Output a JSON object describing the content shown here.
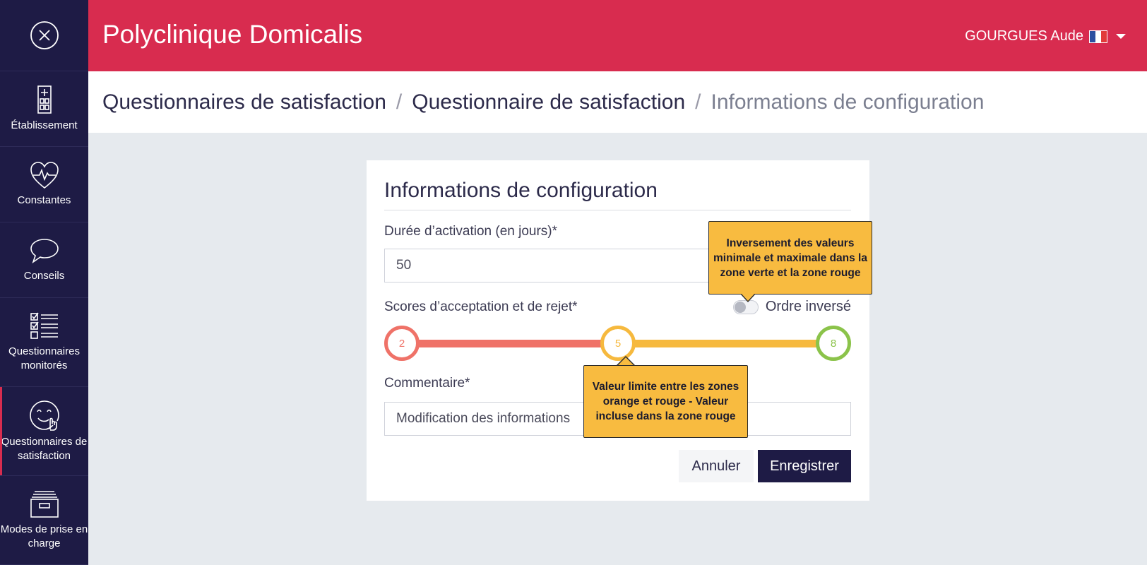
{
  "app": {
    "title": "Polyclinique Domicalis"
  },
  "user": {
    "name": "GOURGUES Aude",
    "flag_icon": "france-flag-icon"
  },
  "sidebar": {
    "items": [
      {
        "label": "Établissement",
        "icon": "hospital-icon"
      },
      {
        "label": "Constantes",
        "icon": "heart-pulse-icon"
      },
      {
        "label": "Conseils",
        "icon": "speech-bubble-icon"
      },
      {
        "label": "Questionnaires monitorés",
        "icon": "checklist-icon"
      },
      {
        "label": "Questionnaires de satisfaction",
        "icon": "smiley-icon",
        "active": true
      },
      {
        "label": "Modes de prise en charge",
        "icon": "archive-box-icon"
      }
    ]
  },
  "breadcrumb": [
    "Questionnaires de satisfaction",
    "Questionnaire de satisfaction",
    "Informations de configuration"
  ],
  "breadcrumb_separator": "/",
  "form": {
    "title": "Informations de configuration",
    "duration_label": "Durée d’activation (en jours)*",
    "duration_value": "50",
    "scores_label": "Scores d’acceptation et de rejet*",
    "reverse_label": "Ordre inversé",
    "reverse_on": false,
    "scores": {
      "min": "2",
      "mid": "5",
      "max": "8"
    },
    "comment_label": "Commentaire*",
    "comment_value": "Modification des informations",
    "cancel_label": "Annuler",
    "save_label": "Enregistrer"
  },
  "tooltips": {
    "reverse": "Inversement des valeurs minimale et maximale dans la zone verte et la zone rouge",
    "limit": "Valeur limite entre les zones orange et rouge - Valeur incluse dans la zone rouge"
  },
  "colors": {
    "brand": "#d82c4f",
    "sidebar": "#1e1b45",
    "red_zone": "#ef7268",
    "orange_zone": "#f6b93e",
    "green_zone": "#8bc34a",
    "tooltip": "#f8bb40"
  }
}
